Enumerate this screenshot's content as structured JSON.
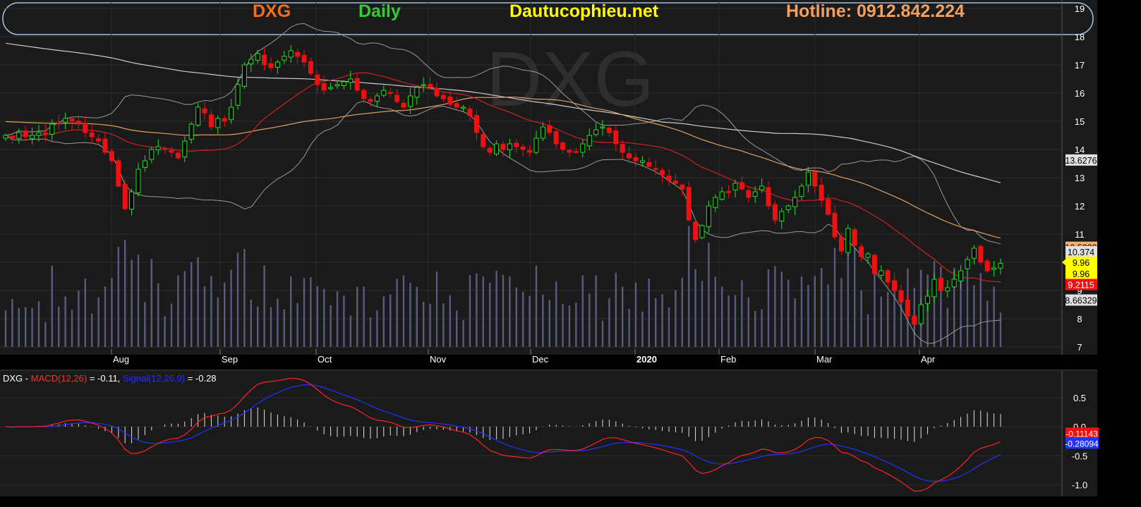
{
  "header": {
    "symbol": "DXG",
    "period": "Daily",
    "site": "Dautucophieu.net",
    "hotline": "Hotline: 0912.842.224",
    "watermark": "DXG"
  },
  "colors": {
    "up": "#22dd22",
    "down": "#ee1111",
    "ma_short": "#cc2222",
    "ma_mid": "#e0a060",
    "ma_long": "#cccccc",
    "band": "#999999",
    "volume": "#5a5a80",
    "macd": "#ff2222",
    "signal": "#2233ff",
    "symbol": "#f07020",
    "period": "#33cc33",
    "site": "#ffff00",
    "hotline": "#f0a060"
  },
  "chart_data": [
    {
      "type": "candlestick",
      "x_months": [
        "Aug",
        "Sep",
        "Oct",
        "Nov",
        "Dec",
        "2020",
        "Feb",
        "Mar",
        "Apr"
      ],
      "y_ticks": [
        7,
        8,
        9,
        10,
        11,
        12,
        13,
        14,
        15,
        16,
        17,
        18,
        19
      ],
      "ylim": [
        7,
        19
      ],
      "close": [
        14.5,
        14.4,
        14.6,
        14.45,
        14.5,
        14.6,
        14.55,
        14.9,
        14.9,
        15.1,
        15.0,
        14.9,
        14.6,
        14.45,
        14.3,
        13.9,
        13.6,
        12.7,
        11.9,
        12.5,
        13.3,
        13.6,
        14.0,
        14.1,
        14.0,
        13.9,
        13.7,
        14.3,
        14.9,
        15.5,
        15.3,
        14.8,
        15.1,
        15.0,
        15.5,
        16.3,
        17.0,
        17.2,
        17.4,
        17.0,
        16.9,
        17.1,
        17.3,
        17.5,
        17.3,
        17.1,
        16.7,
        16.3,
        16.1,
        16.2,
        16.3,
        16.4,
        16.5,
        16.1,
        15.8,
        15.7,
        15.9,
        16.1,
        16.0,
        15.7,
        15.5,
        15.9,
        16.2,
        16.3,
        16.2,
        15.9,
        15.8,
        15.6,
        15.5,
        15.5,
        15.2,
        14.6,
        14.1,
        13.9,
        14.2,
        14.0,
        14.2,
        14.1,
        14.0,
        13.9,
        14.4,
        14.8,
        14.6,
        14.2,
        14.0,
        13.9,
        13.9,
        14.2,
        14.5,
        14.7,
        14.8,
        14.6,
        14.2,
        13.9,
        13.7,
        13.6,
        13.6,
        13.4,
        13.3,
        13.1,
        12.9,
        12.8,
        12.6,
        11.5,
        10.8,
        11.3,
        12.0,
        12.3,
        12.5,
        12.5,
        12.8,
        12.6,
        12.3,
        12.5,
        12.7,
        12.0,
        11.5,
        11.8,
        12.0,
        12.3,
        12.7,
        13.2,
        12.7,
        12.2,
        11.7,
        10.9,
        10.4,
        11.2,
        10.6,
        10.2,
        10.3,
        9.6,
        9.7,
        9.3,
        9.0,
        8.6,
        8.1,
        7.8,
        8.5,
        8.8,
        9.4,
        9.0,
        9.1,
        9.4,
        9.7,
        10.1,
        10.5,
        10.0,
        9.7,
        9.8,
        9.96
      ],
      "last_label": "9.96",
      "right_labels": [
        {
          "text": "13.6276",
          "value": 13.6276,
          "bg": "#e0e0e0",
          "fg": "#000000"
        },
        {
          "text": "10.5338",
          "value": 10.5338,
          "bg": "#f5b070",
          "fg": "#000000"
        },
        {
          "text": "10.374",
          "value": 10.374,
          "bg": "#e0e0e0",
          "fg": "#000000"
        },
        {
          "text": "9.96",
          "value": 10.0,
          "bg": "#ffff00",
          "fg": "#000000"
        },
        {
          "text": "9.96",
          "value": 9.6,
          "bg": "#ffff00",
          "fg": "#000000"
        },
        {
          "text": "9.2115",
          "value": 9.2115,
          "bg": "#ee1111",
          "fg": "#ffffff"
        },
        {
          "text": "8.66329",
          "value": 8.66329,
          "bg": "#e0e0e0",
          "fg": "#000000"
        }
      ]
    },
    {
      "type": "line",
      "legend": {
        "prefix": "DXG - ",
        "macd_name": "MACD(12,26)",
        "macd_value": " = -0.11, ",
        "signal_name": "Signal(12,26,9)",
        "signal_value": " = -0.28"
      },
      "y_ticks": [
        "0.5",
        "0.0",
        "-0.5",
        "-1.0"
      ],
      "y_tick_values": [
        0.5,
        0.0,
        -0.5,
        -1.0
      ],
      "ylim": [
        -1.15,
        0.85
      ],
      "right_labels": [
        {
          "text": "-0.11143",
          "value": -0.11143,
          "bg": "#ee1111",
          "fg": "#ffffff"
        },
        {
          "text": "-0.28094",
          "value": -0.28094,
          "bg": "#2233ff",
          "fg": "#ffffff"
        }
      ]
    }
  ]
}
